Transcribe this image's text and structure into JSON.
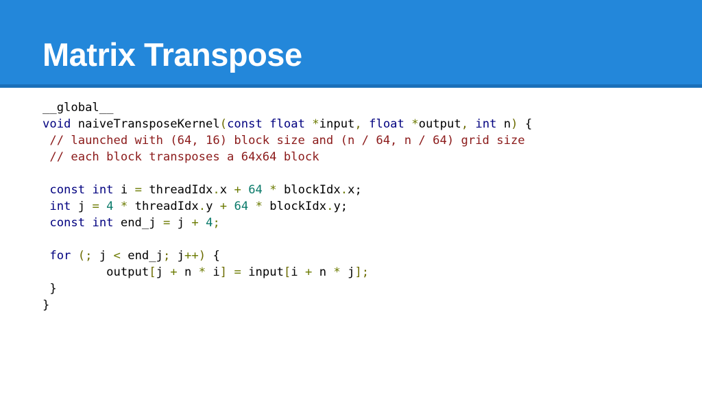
{
  "slide": {
    "title": "Matrix Transpose",
    "colors": {
      "header_bg": "#2387da",
      "header_rule": "#1a6fb8",
      "keyword": "#00007f",
      "comment": "#8b1a1a",
      "number": "#0a7a6a",
      "operator": "#6b7a00"
    }
  },
  "code": {
    "lines": [
      [
        {
          "t": "__global__",
          "c": ""
        }
      ],
      [
        {
          "t": "void",
          "c": "kw"
        },
        {
          "t": " naiveTransposeKernel",
          "c": ""
        },
        {
          "t": "(",
          "c": "pn"
        },
        {
          "t": "const",
          "c": "kw"
        },
        {
          "t": " ",
          "c": ""
        },
        {
          "t": "float",
          "c": "kw"
        },
        {
          "t": " ",
          "c": ""
        },
        {
          "t": "*",
          "c": "op"
        },
        {
          "t": "input",
          "c": ""
        },
        {
          "t": ",",
          "c": "pn"
        },
        {
          "t": " ",
          "c": ""
        },
        {
          "t": "float",
          "c": "kw"
        },
        {
          "t": " ",
          "c": ""
        },
        {
          "t": "*",
          "c": "op"
        },
        {
          "t": "output",
          "c": ""
        },
        {
          "t": ",",
          "c": "pn"
        },
        {
          "t": " ",
          "c": ""
        },
        {
          "t": "int",
          "c": "kw"
        },
        {
          "t": " n",
          "c": ""
        },
        {
          "t": ")",
          "c": "pn"
        },
        {
          "t": " {",
          "c": ""
        }
      ],
      [
        {
          "t": " // launched with (64, 16) block size and (n / 64, n / 64) grid size",
          "c": "cm"
        }
      ],
      [
        {
          "t": " // each block transposes a 64x64 block",
          "c": "cm"
        }
      ],
      [
        {
          "t": "",
          "c": ""
        }
      ],
      [
        {
          "t": " ",
          "c": ""
        },
        {
          "t": "const",
          "c": "kw"
        },
        {
          "t": " ",
          "c": ""
        },
        {
          "t": "int",
          "c": "kw"
        },
        {
          "t": " i ",
          "c": ""
        },
        {
          "t": "=",
          "c": "op"
        },
        {
          "t": " threadIdx",
          "c": ""
        },
        {
          "t": ".",
          "c": "op"
        },
        {
          "t": "x ",
          "c": ""
        },
        {
          "t": "+",
          "c": "op"
        },
        {
          "t": " ",
          "c": ""
        },
        {
          "t": "64",
          "c": "num"
        },
        {
          "t": " ",
          "c": ""
        },
        {
          "t": "*",
          "c": "op"
        },
        {
          "t": " blockIdx",
          "c": ""
        },
        {
          "t": ".",
          "c": "op"
        },
        {
          "t": "x;",
          "c": ""
        }
      ],
      [
        {
          "t": " ",
          "c": ""
        },
        {
          "t": "int",
          "c": "kw"
        },
        {
          "t": " j ",
          "c": ""
        },
        {
          "t": "=",
          "c": "op"
        },
        {
          "t": " ",
          "c": ""
        },
        {
          "t": "4",
          "c": "num"
        },
        {
          "t": " ",
          "c": ""
        },
        {
          "t": "*",
          "c": "op"
        },
        {
          "t": " threadIdx",
          "c": ""
        },
        {
          "t": ".",
          "c": "op"
        },
        {
          "t": "y ",
          "c": ""
        },
        {
          "t": "+",
          "c": "op"
        },
        {
          "t": " ",
          "c": ""
        },
        {
          "t": "64",
          "c": "num"
        },
        {
          "t": " ",
          "c": ""
        },
        {
          "t": "*",
          "c": "op"
        },
        {
          "t": " blockIdx",
          "c": ""
        },
        {
          "t": ".",
          "c": "op"
        },
        {
          "t": "y;",
          "c": ""
        }
      ],
      [
        {
          "t": " ",
          "c": ""
        },
        {
          "t": "const",
          "c": "kw"
        },
        {
          "t": " ",
          "c": ""
        },
        {
          "t": "int",
          "c": "kw"
        },
        {
          "t": " end_j ",
          "c": ""
        },
        {
          "t": "=",
          "c": "op"
        },
        {
          "t": " j ",
          "c": ""
        },
        {
          "t": "+",
          "c": "op"
        },
        {
          "t": " ",
          "c": ""
        },
        {
          "t": "4",
          "c": "num"
        },
        {
          "t": ";",
          "c": "op"
        }
      ],
      [
        {
          "t": "",
          "c": ""
        }
      ],
      [
        {
          "t": " ",
          "c": ""
        },
        {
          "t": "for",
          "c": "kw"
        },
        {
          "t": " ",
          "c": ""
        },
        {
          "t": "(;",
          "c": "pn"
        },
        {
          "t": " j ",
          "c": ""
        },
        {
          "t": "<",
          "c": "op"
        },
        {
          "t": " end_j",
          "c": ""
        },
        {
          "t": ";",
          "c": "pn"
        },
        {
          "t": " j",
          "c": ""
        },
        {
          "t": "++",
          "c": "op"
        },
        {
          "t": ")",
          "c": "pn"
        },
        {
          "t": " {",
          "c": ""
        }
      ],
      [
        {
          "t": "         output",
          "c": ""
        },
        {
          "t": "[",
          "c": "pn"
        },
        {
          "t": "j ",
          "c": ""
        },
        {
          "t": "+",
          "c": "op"
        },
        {
          "t": " n ",
          "c": ""
        },
        {
          "t": "*",
          "c": "op"
        },
        {
          "t": " i",
          "c": ""
        },
        {
          "t": "]",
          "c": "pn"
        },
        {
          "t": " ",
          "c": ""
        },
        {
          "t": "=",
          "c": "op"
        },
        {
          "t": " input",
          "c": ""
        },
        {
          "t": "[",
          "c": "pn"
        },
        {
          "t": "i ",
          "c": ""
        },
        {
          "t": "+",
          "c": "op"
        },
        {
          "t": " n ",
          "c": ""
        },
        {
          "t": "*",
          "c": "op"
        },
        {
          "t": " j",
          "c": ""
        },
        {
          "t": "];",
          "c": "pn"
        }
      ],
      [
        {
          "t": " }",
          "c": ""
        }
      ],
      [
        {
          "t": "}",
          "c": ""
        }
      ]
    ]
  }
}
